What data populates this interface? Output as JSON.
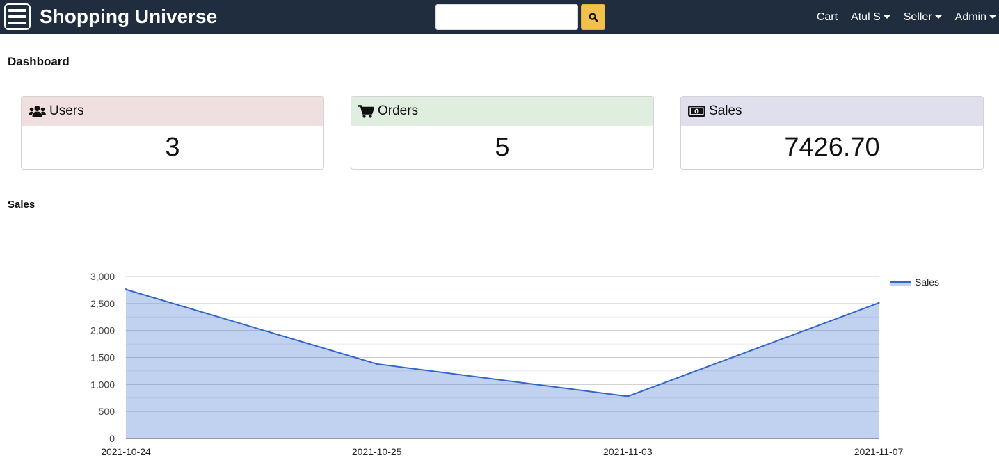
{
  "navbar": {
    "brand": "Shopping Universe",
    "search": {
      "value": "",
      "placeholder": ""
    },
    "links": {
      "cart": "Cart",
      "user": "Atul S",
      "seller": "Seller",
      "admin": "Admin"
    }
  },
  "page_title": "Dashboard",
  "cards": {
    "users": {
      "label": "Users",
      "value": "3",
      "icon": "users-icon",
      "header_color": "#f0dfdf"
    },
    "orders": {
      "label": "Orders",
      "value": "5",
      "icon": "shopping-cart-icon",
      "header_color": "#dfeedf"
    },
    "sales": {
      "label": "Sales",
      "value": "7426.70",
      "icon": "money-bill-icon",
      "header_color": "#e0dfee"
    }
  },
  "sales_section_title": "Sales",
  "chart_data": {
    "type": "area",
    "title": "",
    "xlabel": "",
    "ylabel": "",
    "categories": [
      "2021-10-24",
      "2021-10-25",
      "2021-11-03",
      "2021-11-07"
    ],
    "series": [
      {
        "name": "Sales",
        "values": [
          2760,
          1380,
          780,
          2510
        ],
        "color": "#3366cc"
      }
    ],
    "ylim": [
      0,
      3000
    ],
    "yticks": [
      0,
      500,
      1000,
      1500,
      2000,
      2500,
      3000
    ],
    "ytick_labels": [
      "0",
      "500",
      "1,000",
      "1,500",
      "2,000",
      "2,500",
      "3,000"
    ],
    "grid": true,
    "legend_position": "right"
  }
}
